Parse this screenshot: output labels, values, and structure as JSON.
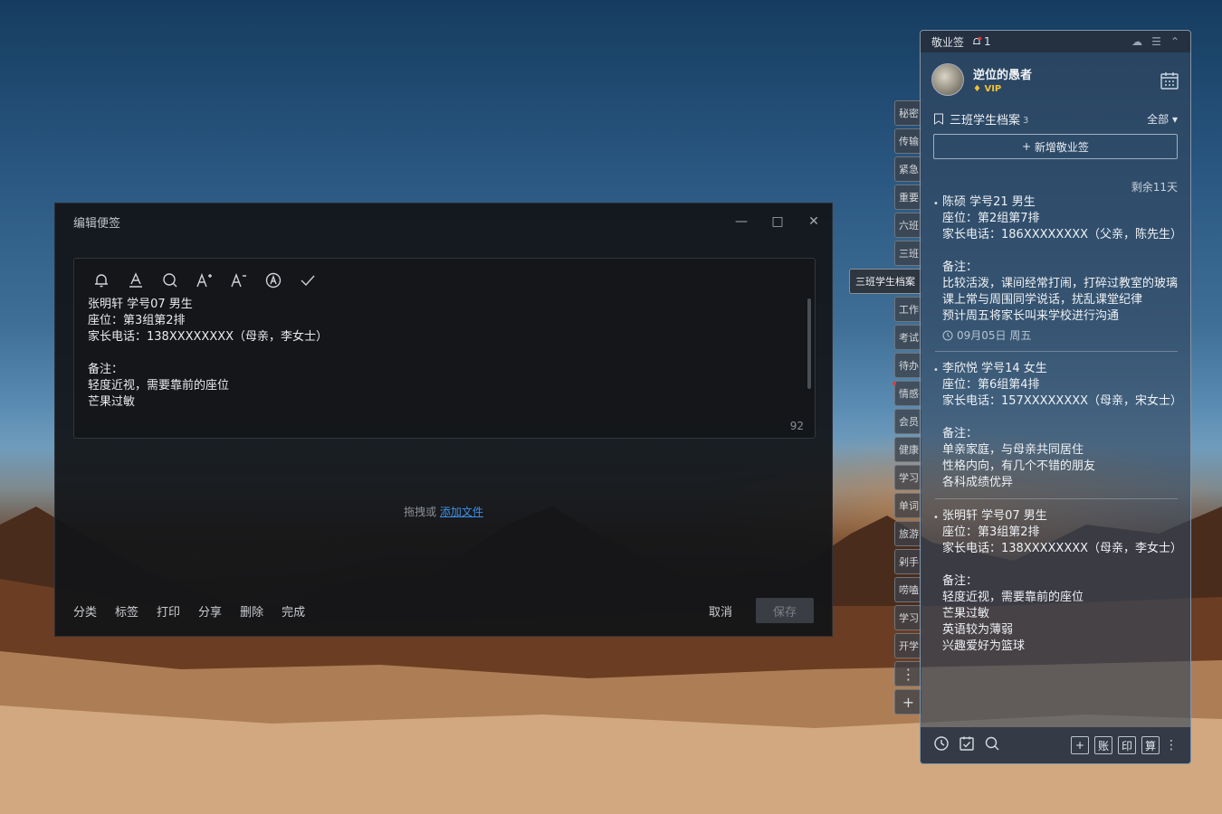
{
  "editor": {
    "title": "编辑便签",
    "content_lines": [
      "张明轩 学号07 男生",
      "座位：第3组第2排",
      "家长电话：138XXXXXXXX（母亲，李女士）",
      "",
      "备注：",
      "轻度近视，需要靠前的座位",
      "芒果过敏"
    ],
    "char_count": "92",
    "drop_text": "拖拽或",
    "drop_link": "添加文件",
    "actions": {
      "category": "分类",
      "tag": "标签",
      "print": "打印",
      "share": "分享",
      "delete": "删除",
      "done": "完成"
    },
    "cancel": "取消",
    "save": "保存"
  },
  "tabs": [
    "秘密",
    "传输",
    "紧急",
    "重要",
    "六班",
    "三班",
    "三班学生档案",
    "工作",
    "考试",
    "待办",
    "情感",
    "会员",
    "健康",
    "学习",
    "单词",
    "旅游",
    "剁手",
    "唠嗑",
    "学习",
    "开学"
  ],
  "panel": {
    "app_name": "敬业签",
    "notification_count": "1",
    "username": "逆位的愚者",
    "vip": "VIP",
    "category": "三班学生档案",
    "category_count": "3",
    "filter": "全部",
    "new_note": "新增敬业签",
    "remaining": "剩余11天",
    "notes": [
      {
        "lines": [
          "陈硕 学号21 男生",
          "座位：第2组第7排",
          "家长电话：186XXXXXXXX（父亲，陈先生）",
          "",
          "备注：",
          "比较活泼，课间经常打闹，打碎过教室的玻璃",
          "课上常与周围同学说话，扰乱课堂纪律",
          "预计周五将家长叫来学校进行沟通"
        ],
        "date": "09月05日 周五"
      },
      {
        "lines": [
          "李欣悦 学号14 女生",
          "座位：第6组第4排",
          "家长电话：157XXXXXXXX（母亲，宋女士）",
          "",
          "备注：",
          "单亲家庭，与母亲共同居住",
          "性格内向，有几个不错的朋友",
          "各科成绩优异"
        ],
        "date": ""
      },
      {
        "lines": [
          "张明轩 学号07 男生",
          "座位：第3组第2排",
          "家长电话：138XXXXXXXX（母亲，李女士）",
          "",
          "备注：",
          "轻度近视，需要靠前的座位",
          "芒果过敏",
          "英语较为薄弱",
          "兴趣爱好为篮球"
        ],
        "date": ""
      }
    ],
    "bottom_tools": [
      "账",
      "印",
      "算"
    ]
  }
}
